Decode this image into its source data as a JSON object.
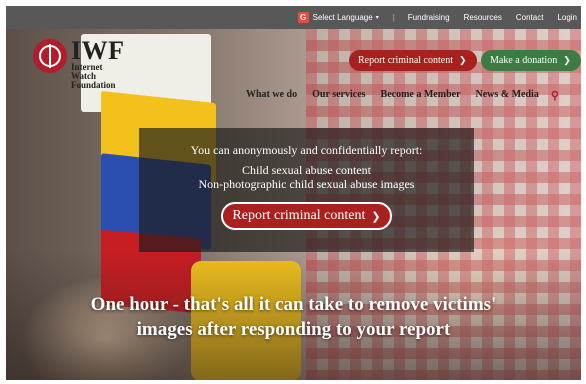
{
  "topbar": {
    "language_label": "Select Language",
    "links": [
      "Fundraising",
      "Resources",
      "Contact",
      "Login"
    ]
  },
  "logo": {
    "name": "IWF",
    "subtitle": [
      "Internet",
      "Watch",
      "Foundation"
    ]
  },
  "header_buttons": {
    "report_label": "Report criminal content",
    "donate_label": "Make a donation"
  },
  "nav": {
    "items": [
      "What we do",
      "Our services",
      "Become a Member",
      "News & Media"
    ]
  },
  "panel": {
    "intro": "You can anonymously and confidentially report:",
    "item1": "Child sexual abuse content",
    "item2": "Non-photographic child sexual abuse images",
    "button_label": "Report criminal content"
  },
  "headline": {
    "line1": "One hour - that's all it can take to remove victims'",
    "line2": "images after responding to your report"
  },
  "colors": {
    "brand_red": "#a8211f",
    "donate_green": "#3d7b45",
    "topbar_gray": "#585858"
  }
}
